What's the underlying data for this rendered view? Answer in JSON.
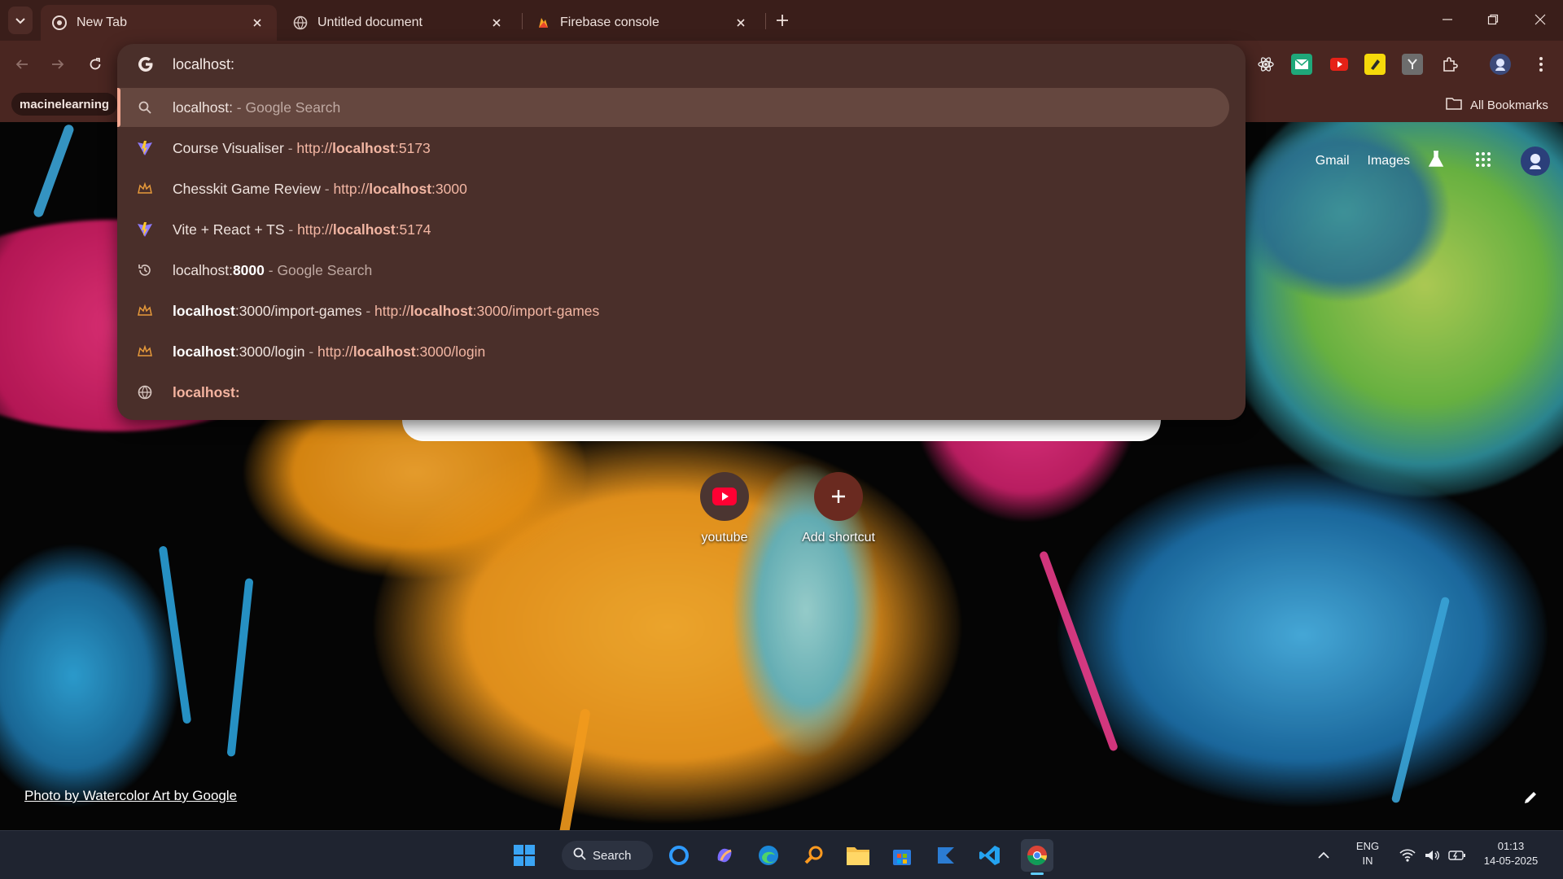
{
  "browser": {
    "tabs": [
      {
        "title": "New Tab",
        "active": true,
        "icon": "chrome-icon"
      },
      {
        "title": "Untitled document",
        "active": false,
        "icon": "globe-icon"
      },
      {
        "title": "Firebase console",
        "active": false,
        "icon": "firebase-icon"
      }
    ],
    "bookmarks": {
      "chip": "macinelearning",
      "all": "All Bookmarks"
    }
  },
  "omnibox": {
    "input": "localhost:",
    "suggestions": [
      {
        "icon": "search-icon",
        "parts": [
          [
            "localhost:",
            false,
            "t"
          ],
          [
            " - ",
            false,
            "sep"
          ],
          [
            "Google Search",
            false,
            "sep"
          ]
        ]
      },
      {
        "icon": "vite-icon",
        "parts": [
          [
            "Course Visualiser",
            false,
            "t"
          ],
          [
            " - ",
            false,
            "sep"
          ],
          [
            "http://",
            false,
            "u"
          ],
          [
            "localhost",
            true,
            "u"
          ],
          [
            ":5173",
            false,
            "u"
          ]
        ]
      },
      {
        "icon": "chesskit-icon",
        "parts": [
          [
            "Chesskit Game Review",
            false,
            "t"
          ],
          [
            " - ",
            false,
            "sep"
          ],
          [
            "http://",
            false,
            "u"
          ],
          [
            "localhost",
            true,
            "u"
          ],
          [
            ":3000",
            false,
            "u"
          ]
        ]
      },
      {
        "icon": "vite-icon",
        "parts": [
          [
            "Vite + React + TS",
            false,
            "t"
          ],
          [
            " - ",
            false,
            "sep"
          ],
          [
            "http://",
            false,
            "u"
          ],
          [
            "localhost",
            true,
            "u"
          ],
          [
            ":5174",
            false,
            "u"
          ]
        ]
      },
      {
        "icon": "history-icon",
        "parts": [
          [
            "localhost:",
            false,
            "t"
          ],
          [
            "8000",
            true,
            "t"
          ],
          [
            " - ",
            false,
            "sep"
          ],
          [
            "Google Search",
            false,
            "sep"
          ]
        ]
      },
      {
        "icon": "chesskit-icon",
        "parts": [
          [
            "localhost",
            true,
            "t"
          ],
          [
            ":3000/import-games",
            false,
            "t"
          ],
          [
            " - ",
            false,
            "sep"
          ],
          [
            "http://",
            false,
            "u"
          ],
          [
            "localhost",
            true,
            "u"
          ],
          [
            ":3000/import-games",
            false,
            "u"
          ]
        ]
      },
      {
        "icon": "chesskit-icon",
        "parts": [
          [
            "localhost",
            true,
            "t"
          ],
          [
            ":3000/login",
            false,
            "t"
          ],
          [
            " - ",
            false,
            "sep"
          ],
          [
            "http://",
            false,
            "u"
          ],
          [
            "localhost",
            true,
            "u"
          ],
          [
            ":3000/login",
            false,
            "u"
          ]
        ]
      },
      {
        "icon": "globe-icon",
        "parts": [
          [
            "localhost:",
            true,
            "a"
          ]
        ]
      }
    ]
  },
  "ntp": {
    "links": {
      "gmail": "Gmail",
      "images": "Images"
    },
    "shortcuts": [
      {
        "label": "youtube",
        "icon": "youtube-icon"
      },
      {
        "label": "Add shortcut",
        "icon": "plus-icon"
      }
    ],
    "credit": "Photo by Watercolor Art by Google"
  },
  "taskbar": {
    "search": "Search",
    "lang": {
      "line1": "ENG",
      "line2": "IN"
    },
    "clock": {
      "time": "01:13",
      "date": "14-05-2025"
    }
  },
  "colors": {
    "titlebar": "#3a1e1a",
    "toolbar": "#4a2621",
    "dropdown": "#4a2f2a",
    "accent": "#f4a891"
  }
}
